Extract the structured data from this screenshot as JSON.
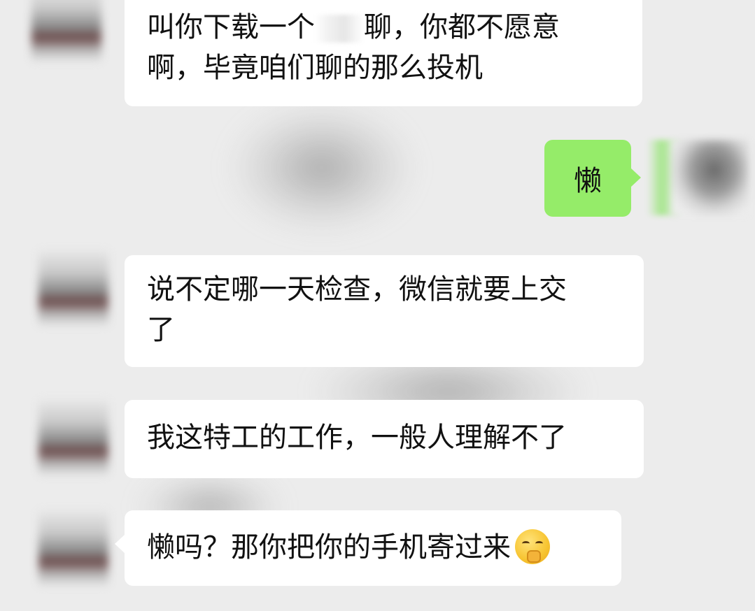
{
  "chat": {
    "messages": [
      {
        "side": "left",
        "line1_a": "叫你下载一个",
        "line1_b": "聊，你都不愿意",
        "line2": "啊，毕竟咱们聊的那么投机"
      },
      {
        "side": "right",
        "text": "懒"
      },
      {
        "side": "left",
        "line1": "说不定哪一天检查，微信就要上交",
        "line2": "了"
      },
      {
        "side": "left",
        "text": "我这特工的工作，一般人理解不了"
      },
      {
        "side": "left",
        "text": "懒吗？那你把你的手机寄过来",
        "emoji": "shushing-face-emoji"
      }
    ]
  },
  "colors": {
    "background": "#ececec",
    "incoming_bubble": "#ffffff",
    "outgoing_bubble": "#95ec69",
    "text": "#111111"
  }
}
